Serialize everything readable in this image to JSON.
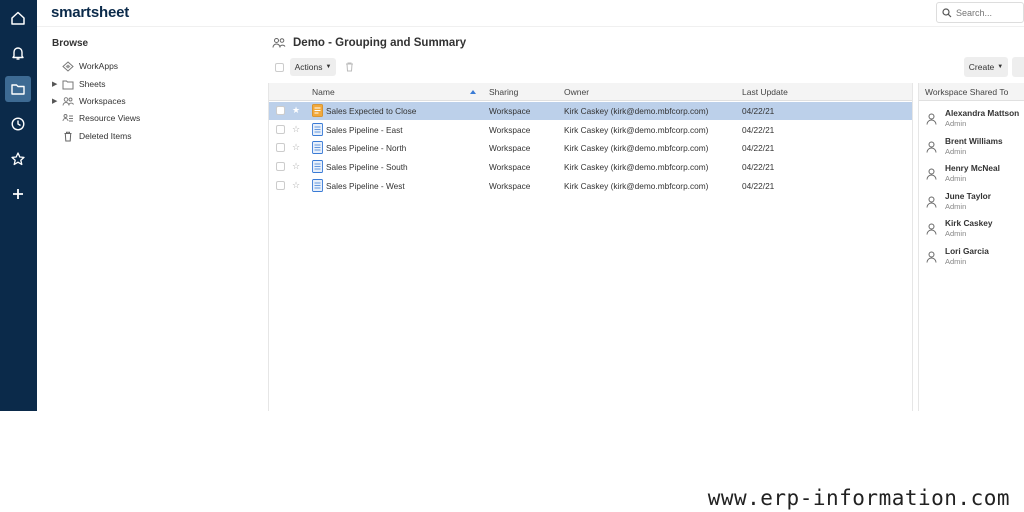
{
  "app": {
    "logo": "smartsheet"
  },
  "search": {
    "placeholder": "Search..."
  },
  "browse": {
    "title": "Browse",
    "items": [
      {
        "label": "WorkApps",
        "icon": "workapps-icon",
        "expandable": false
      },
      {
        "label": "Sheets",
        "icon": "folder-icon",
        "expandable": true
      },
      {
        "label": "Workspaces",
        "icon": "workspaces-icon",
        "expandable": true
      },
      {
        "label": "Resource Views",
        "icon": "resource-views-icon",
        "expandable": false
      },
      {
        "label": "Deleted Items",
        "icon": "trash-icon",
        "expandable": false
      }
    ]
  },
  "main": {
    "title": "Demo - Grouping and Summary",
    "actions_label": "Actions",
    "create_label": "Create",
    "columns": {
      "name": "Name",
      "sharing": "Sharing",
      "owner": "Owner",
      "last_update": "Last Update"
    },
    "rows": [
      {
        "name": "Sales Expected to Close",
        "sharing": "Workspace",
        "owner": "Kirk Caskey (kirk@demo.mbfcorp.com)",
        "last_update": "04/22/21",
        "type": "report",
        "selected": true
      },
      {
        "name": "Sales Pipeline - East",
        "sharing": "Workspace",
        "owner": "Kirk Caskey (kirk@demo.mbfcorp.com)",
        "last_update": "04/22/21",
        "type": "sheet",
        "selected": false
      },
      {
        "name": "Sales Pipeline - North",
        "sharing": "Workspace",
        "owner": "Kirk Caskey (kirk@demo.mbfcorp.com)",
        "last_update": "04/22/21",
        "type": "sheet",
        "selected": false
      },
      {
        "name": "Sales Pipeline - South",
        "sharing": "Workspace",
        "owner": "Kirk Caskey (kirk@demo.mbfcorp.com)",
        "last_update": "04/22/21",
        "type": "sheet",
        "selected": false
      },
      {
        "name": "Sales Pipeline - West",
        "sharing": "Workspace",
        "owner": "Kirk Caskey (kirk@demo.mbfcorp.com)",
        "last_update": "04/22/21",
        "type": "sheet",
        "selected": false
      }
    ]
  },
  "shared": {
    "title": "Workspace Shared To",
    "members": [
      {
        "name": "Alexandra Mattson",
        "role": "Admin"
      },
      {
        "name": "Brent Williams",
        "role": "Admin"
      },
      {
        "name": "Henry McNeal",
        "role": "Admin"
      },
      {
        "name": "June Taylor",
        "role": "Admin"
      },
      {
        "name": "Kirk Caskey",
        "role": "Admin"
      },
      {
        "name": "Lori Garcia",
        "role": "Admin"
      }
    ]
  },
  "watermark": "www.erp-information.com",
  "colors": {
    "rail": "#0b2a4a",
    "rail_active": "#3d6a93",
    "selected_row": "#bcd0ea",
    "sheet_icon": "#3a7bd5",
    "report_icon": "#f2a93b"
  }
}
